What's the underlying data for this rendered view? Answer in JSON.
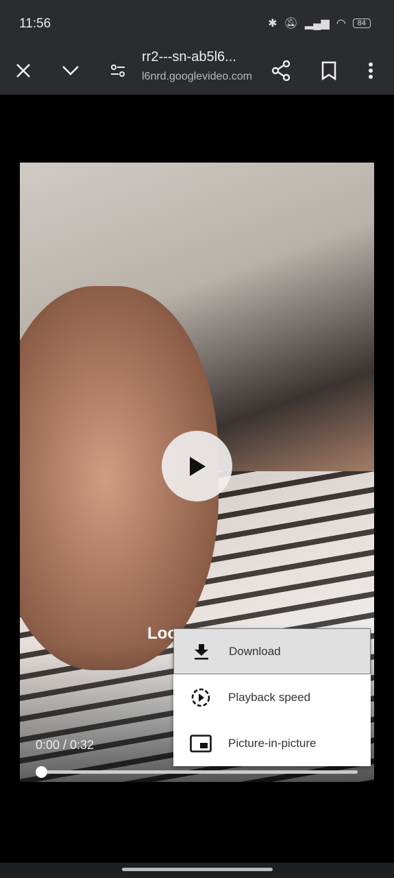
{
  "status_bar": {
    "time": "11:56",
    "battery": "84",
    "icons": [
      "bluetooth-icon",
      "mute-icon",
      "signal-icon",
      "wifi-icon",
      "battery-icon"
    ]
  },
  "toolbar": {
    "title": "rr2---sn-ab5l6...",
    "url": "l6nrd.googlevideo.com",
    "icons": [
      "close-icon",
      "chevron-down-icon",
      "tune-icon",
      "share-icon",
      "bookmark-icon",
      "more-vert-icon"
    ]
  },
  "video": {
    "caption": "Loo",
    "time": "0:00 / 0:32",
    "progress": 0
  },
  "menu": {
    "items": [
      {
        "label": "Download",
        "icon": "download-icon",
        "selected": true
      },
      {
        "label": "Playback speed",
        "icon": "playback-speed-icon"
      },
      {
        "label": "Picture-in-picture",
        "icon": "pip-icon"
      }
    ]
  }
}
